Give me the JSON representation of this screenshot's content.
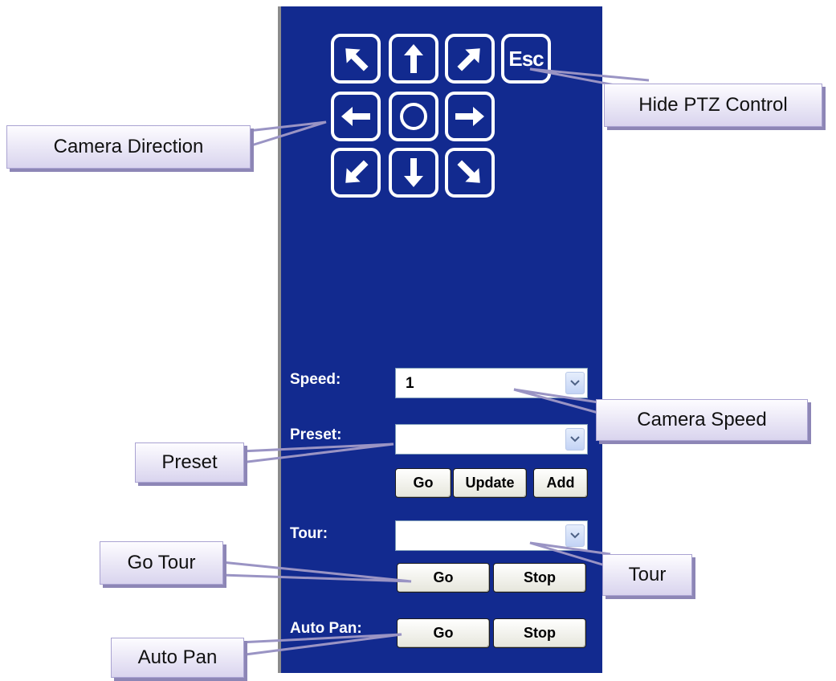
{
  "ptz": {
    "directions": [
      {
        "name": "up-left-arrow-icon",
        "label": "up-left"
      },
      {
        "name": "up-arrow-icon",
        "label": "up"
      },
      {
        "name": "up-right-arrow-icon",
        "label": "up-right"
      },
      {
        "name": "left-arrow-icon",
        "label": "left"
      },
      {
        "name": "home-circle-icon",
        "label": "home"
      },
      {
        "name": "right-arrow-icon",
        "label": "right"
      },
      {
        "name": "down-left-arrow-icon",
        "label": "down-left"
      },
      {
        "name": "down-arrow-icon",
        "label": "down"
      },
      {
        "name": "down-right-arrow-icon",
        "label": "down-right"
      }
    ],
    "esc_label": "Esc"
  },
  "speed": {
    "label": "Speed:",
    "value": "1"
  },
  "preset": {
    "label": "Preset:",
    "value": "",
    "buttons": {
      "go": "Go",
      "update": "Update",
      "add": "Add"
    }
  },
  "tour": {
    "label": "Tour:",
    "value": "",
    "buttons": {
      "go": "Go",
      "stop": "Stop"
    }
  },
  "auto_pan": {
    "label": "Auto Pan:",
    "buttons": {
      "go": "Go",
      "stop": "Stop"
    }
  },
  "callouts": {
    "camera_direction": "Camera Direction",
    "hide_ptz": "Hide PTZ Control",
    "camera_speed": "Camera Speed",
    "preset": "Preset",
    "go_tour": "Go Tour",
    "tour": "Tour",
    "auto_pan": "Auto Pan"
  },
  "colors": {
    "panel_bg": "#122a8f",
    "callout_fill": "#e8e4f6",
    "button_face": "#f4f4ee"
  }
}
